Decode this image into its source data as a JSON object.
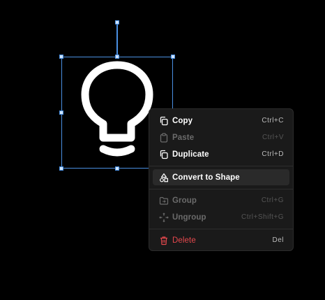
{
  "menu": {
    "items": [
      {
        "label": "Copy",
        "shortcut": "Ctrl+C",
        "icon": "copy-icon",
        "state": "enabled"
      },
      {
        "label": "Paste",
        "shortcut": "Ctrl+V",
        "icon": "paste-icon",
        "state": "disabled"
      },
      {
        "label": "Duplicate",
        "shortcut": "Ctrl+D",
        "icon": "duplicate-icon",
        "state": "enabled"
      },
      {
        "label": "Convert to Shape",
        "shortcut": "",
        "icon": "shapes-icon",
        "state": "highlighted"
      },
      {
        "label": "Group",
        "shortcut": "Ctrl+G",
        "icon": "group-icon",
        "state": "disabled"
      },
      {
        "label": "Ungroup",
        "shortcut": "Ctrl+Shift+G",
        "icon": "ungroup-icon",
        "state": "disabled"
      },
      {
        "label": "Delete",
        "shortcut": "Del",
        "icon": "trash-icon",
        "state": "danger"
      }
    ]
  },
  "colors": {
    "selection": "#4a90e2",
    "menu_bg": "#1a1a1a",
    "danger": "#e5484d",
    "canvas_bg": "#000000"
  }
}
